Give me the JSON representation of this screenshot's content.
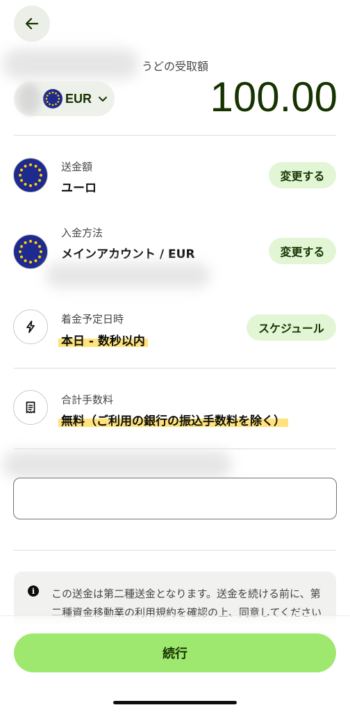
{
  "header": {
    "recipient_receive_label": "うどの受取額"
  },
  "amount": {
    "currency_code": "EUR",
    "value": "100.00"
  },
  "rows": [
    {
      "label": "送金額",
      "value": "ユーロ",
      "action": "変更する",
      "icon": "eu-flag-icon"
    },
    {
      "label": "入金方法",
      "value": "メインアカウント / EUR",
      "action": "変更する",
      "icon": "eu-flag-icon"
    },
    {
      "label": "着金予定日時",
      "value": "本日 - 数秒以内",
      "action": "スケジュール",
      "icon": "lightning-icon"
    },
    {
      "label": "合計手数料",
      "value": "無料（ご利用の銀行の振込手数料を除く）",
      "icon": "receipt-icon"
    }
  ],
  "notice": {
    "text": "この送金は第二種送金となります。送金を続ける前に、第二種資金移動業の利用規約を確認の上、同意してください"
  },
  "footer": {
    "continue_label": "続行"
  },
  "colors": {
    "accent": "#9fe870",
    "accent_light": "#e2f6d5",
    "text_dark": "#163300",
    "highlight": "#ffe27a"
  }
}
